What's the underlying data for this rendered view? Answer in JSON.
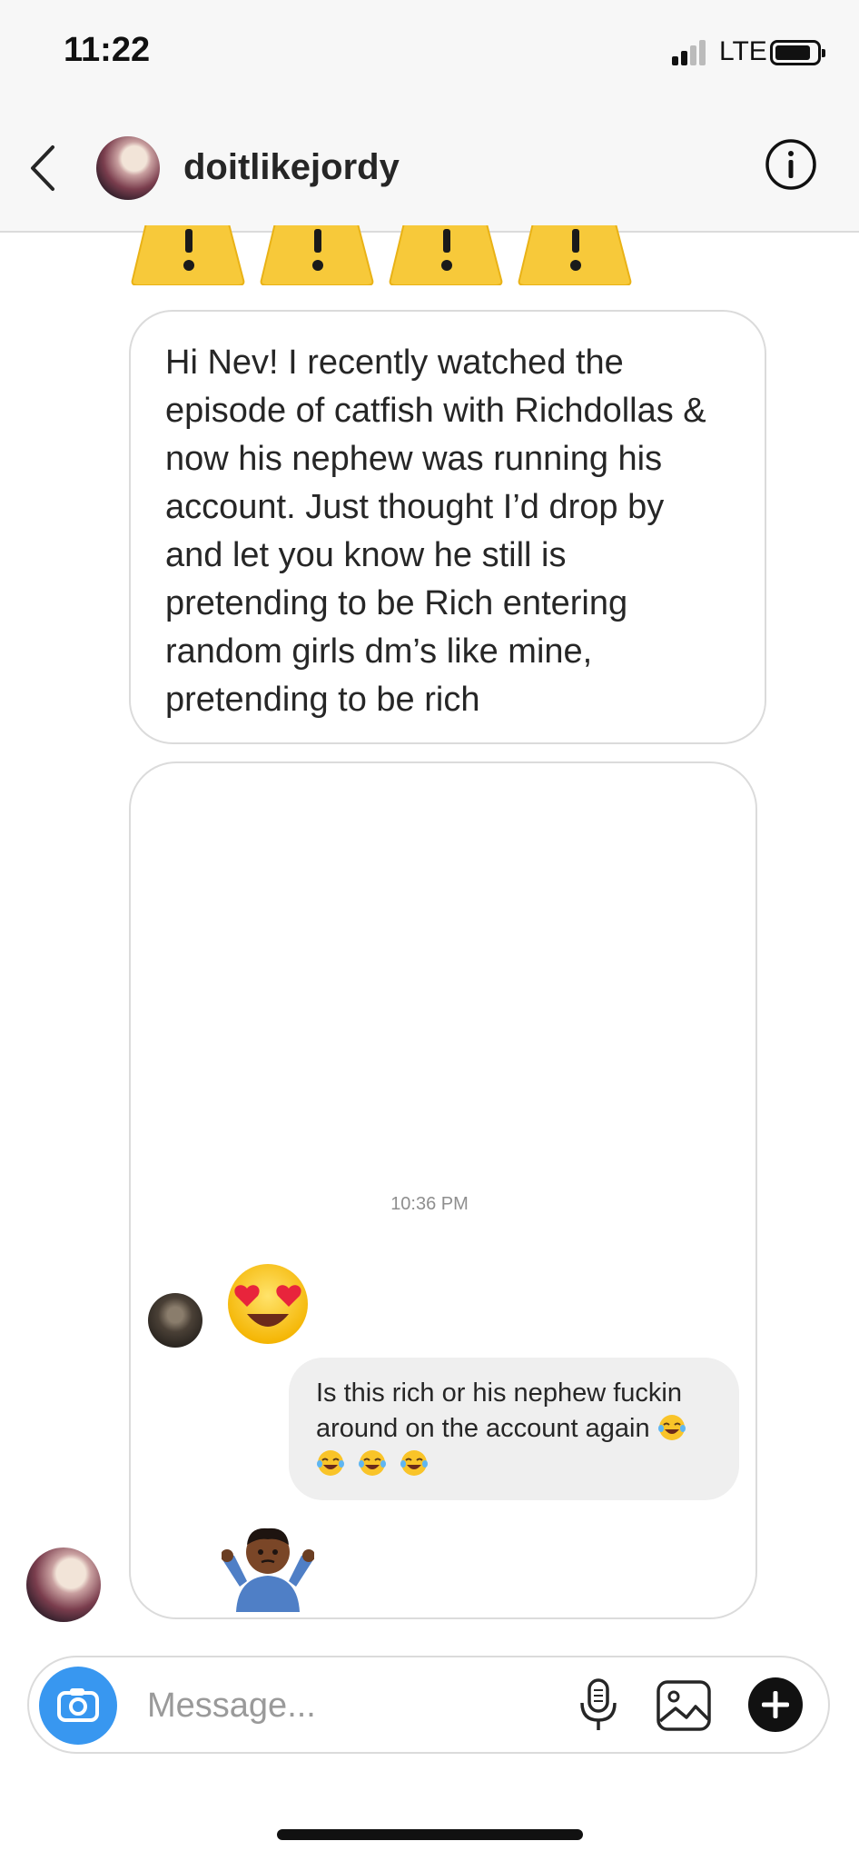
{
  "status_bar": {
    "time": "11:22",
    "network": "LTE",
    "signal_icon": "signal-bars-icon",
    "battery_icon": "battery-icon"
  },
  "header": {
    "username": "doitlikejordy",
    "back_icon": "chevron-left-icon",
    "info_icon": "info-circle-icon"
  },
  "messages": {
    "warning_icons": [
      "warning-emoji",
      "warning-emoji",
      "warning-emoji",
      "warning-emoji"
    ],
    "outgoing_text": "Hi Nev! I recently watched the episode of catfish with Richdollas & now his nephew was running his account. Just thought I’d drop by and let you know he still is pretending to be Rich entering random girls dm’s like mine, pretending to be rich",
    "shared_screenshot": {
      "timestamp": "10:36 PM",
      "reaction_emoji": "heart-eyes-emoji",
      "reply_text": "Is this rich or his nephew fuckin around on the account again",
      "reply_emojis": [
        "tears-of-joy-emoji",
        "tears-of-joy-emoji",
        "tears-of-joy-emoji",
        "tears-of-joy-emoji"
      ],
      "shrug_emoji": "person-shrugging-emoji"
    }
  },
  "composer": {
    "placeholder": "Message...",
    "camera_icon": "camera-icon",
    "mic_icon": "microphone-icon",
    "gallery_icon": "gallery-icon",
    "plus_icon": "plus-circle-icon"
  },
  "colors": {
    "accent_blue": "#3897f0",
    "bubble_gray": "#efefef",
    "border_gray": "#dbdbdb",
    "header_bg": "#f7f7f7"
  }
}
